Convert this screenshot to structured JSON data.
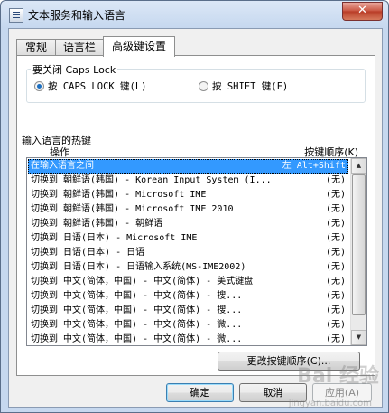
{
  "window": {
    "title": "文本服务和输入语言",
    "close_glyph": "✕"
  },
  "tabs": [
    {
      "label": "常规"
    },
    {
      "label": "语言栏"
    },
    {
      "label": "高级键设置"
    }
  ],
  "caps_group": {
    "legend": "要关闭 Caps Lock",
    "options": [
      {
        "label": "按 CAPS LOCK 键(L)",
        "selected": true
      },
      {
        "label": "按 SHIFT 键(F)",
        "selected": false
      }
    ]
  },
  "hotkey_group": {
    "legend": "输入语言的热键",
    "col_action": "操作",
    "col_keys": "按键顺序(K)",
    "rows": [
      {
        "action": "在输入语言之间",
        "keys": "左 Alt+Shift",
        "selected": true
      },
      {
        "action": "切换到 朝鲜语(韩国) - Korean Input System (I...",
        "keys": "(无)"
      },
      {
        "action": "切换到 朝鲜语(韩国) - Microsoft IME",
        "keys": "(无)"
      },
      {
        "action": "切换到 朝鲜语(韩国) - Microsoft IME 2010",
        "keys": "(无)"
      },
      {
        "action": "切换到 朝鲜语(韩国) - 朝鲜语",
        "keys": "(无)"
      },
      {
        "action": "切换到 日语(日本) - Microsoft IME",
        "keys": "(无)"
      },
      {
        "action": "切换到 日语(日本) - 日语",
        "keys": "(无)"
      },
      {
        "action": "切换到 日语(日本) - 日语输入系统(MS-IME2002)",
        "keys": "(无)"
      },
      {
        "action": "切换到 中文(简体，中国) - 中文(简体) - 美式键盘",
        "keys": "(无)"
      },
      {
        "action": "切换到 中文(简体，中国) - 中文(简体) - 搜...",
        "keys": "(无)"
      },
      {
        "action": "切换到 中文(简体，中国) - 中文(简体) - 搜...",
        "keys": "(无)"
      },
      {
        "action": "切换到 中文(简体，中国) - 中文(简体) - 微...",
        "keys": "(无)"
      },
      {
        "action": "切换到 中文(简体，中国) - 中文(简体) - 微...",
        "keys": "(无)"
      }
    ],
    "change_button": "更改按键顺序(C)..."
  },
  "footer": {
    "ok": "确定",
    "cancel": "取消",
    "apply": "应用(A)"
  },
  "watermark": {
    "brand": "Bai 经验",
    "sub": "jingyan.baidu.com"
  },
  "icons": {
    "app": "settings-window-icon",
    "close": "close-icon",
    "scroll_up": "scroll-up-icon",
    "scroll_down": "scroll-down-icon"
  },
  "colors": {
    "selection": "#3399ff",
    "titlebar": "#c6d8ef",
    "close": "#c8533f"
  }
}
